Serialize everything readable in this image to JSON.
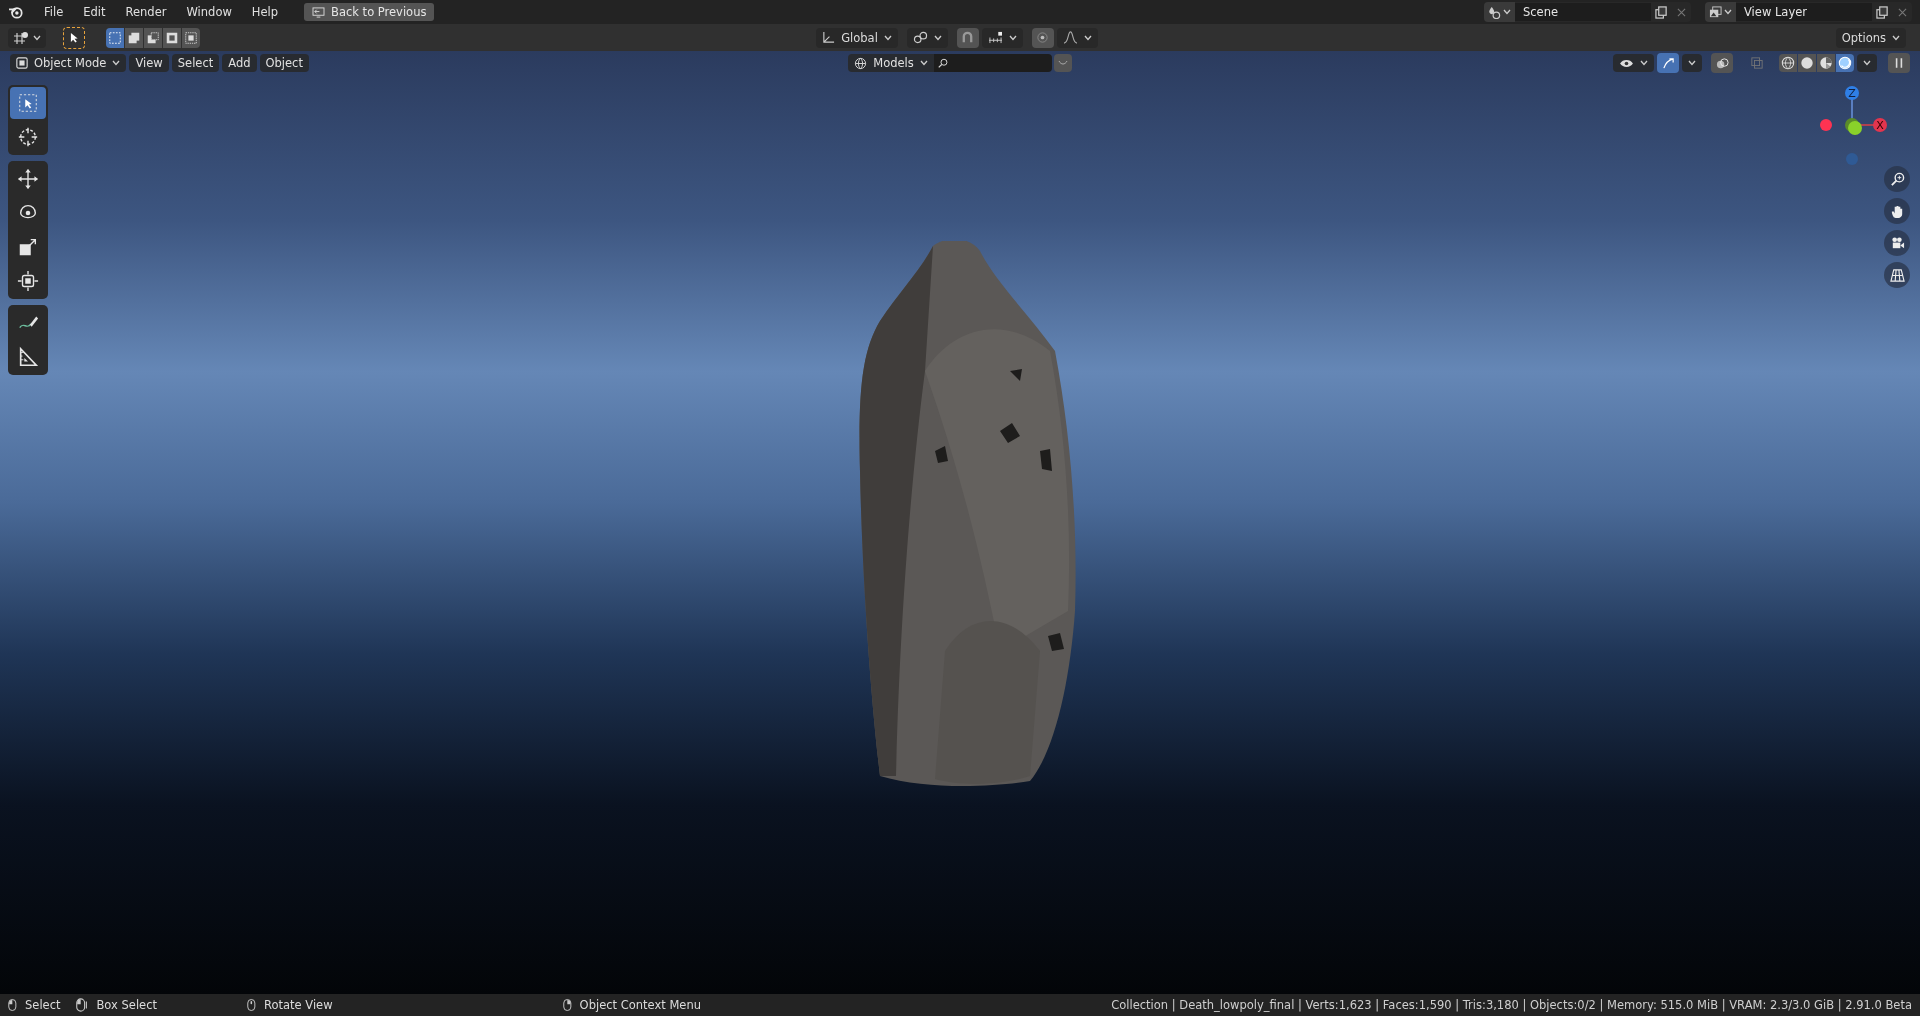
{
  "menu_bar": {
    "menus": [
      "File",
      "Edit",
      "Render",
      "Window",
      "Help"
    ],
    "back_button": "Back to Previous",
    "scene": {
      "value": "Scene"
    },
    "view_layer": {
      "value": "View Layer"
    }
  },
  "tool_settings": {
    "selection_modes": [
      {
        "kind": "set",
        "selected": true
      },
      {
        "kind": "extend",
        "selected": false
      },
      {
        "kind": "subtract",
        "selected": false
      },
      {
        "kind": "difference",
        "selected": false
      },
      {
        "kind": "intersect",
        "selected": false
      }
    ],
    "orientation": "Global",
    "snap_on": false,
    "proportional_on": false,
    "options": "Options"
  },
  "viewport_header": {
    "mode": "Object Mode",
    "menus": [
      "View",
      "Select",
      "Add",
      "Object"
    ],
    "collection_filter": "Models",
    "gizmos_on": true,
    "shading": [
      {
        "kind": "wireframe",
        "selected": false
      },
      {
        "kind": "solid",
        "selected": false
      },
      {
        "kind": "material",
        "selected": false
      },
      {
        "kind": "rendered",
        "selected": true
      }
    ]
  },
  "toolbar": [
    {
      "kind": "select-box",
      "selected": true
    },
    {
      "kind": "cursor",
      "selected": false
    },
    {
      "kind": "move",
      "selected": false
    },
    {
      "kind": "rotate",
      "selected": false
    },
    {
      "kind": "scale",
      "selected": false
    },
    {
      "kind": "transform",
      "selected": false
    },
    {
      "kind": "annotate",
      "selected": false
    },
    {
      "kind": "measure",
      "selected": false
    }
  ],
  "gizmo": {
    "axes": [
      {
        "label": "Z",
        "color": "#2f7fe6"
      },
      {
        "label": "X",
        "color": "#e3354e"
      }
    ]
  },
  "status_bar": {
    "hints": [
      {
        "kind": "left",
        "text": "Select"
      },
      {
        "kind": "left-drag",
        "text": "Box Select"
      },
      {
        "kind": "middle",
        "text": "Rotate View"
      },
      {
        "kind": "right",
        "text": "Object Context Menu"
      }
    ],
    "stats": "Collection | Death_lowpoly_final | Verts:1,623 | Faces:1,590 | Tris:3,180 | Objects:0/2 | Memory: 515.0 MiB | VRAM: 2.3/3.0 GiB | 2.91.0 Beta"
  }
}
